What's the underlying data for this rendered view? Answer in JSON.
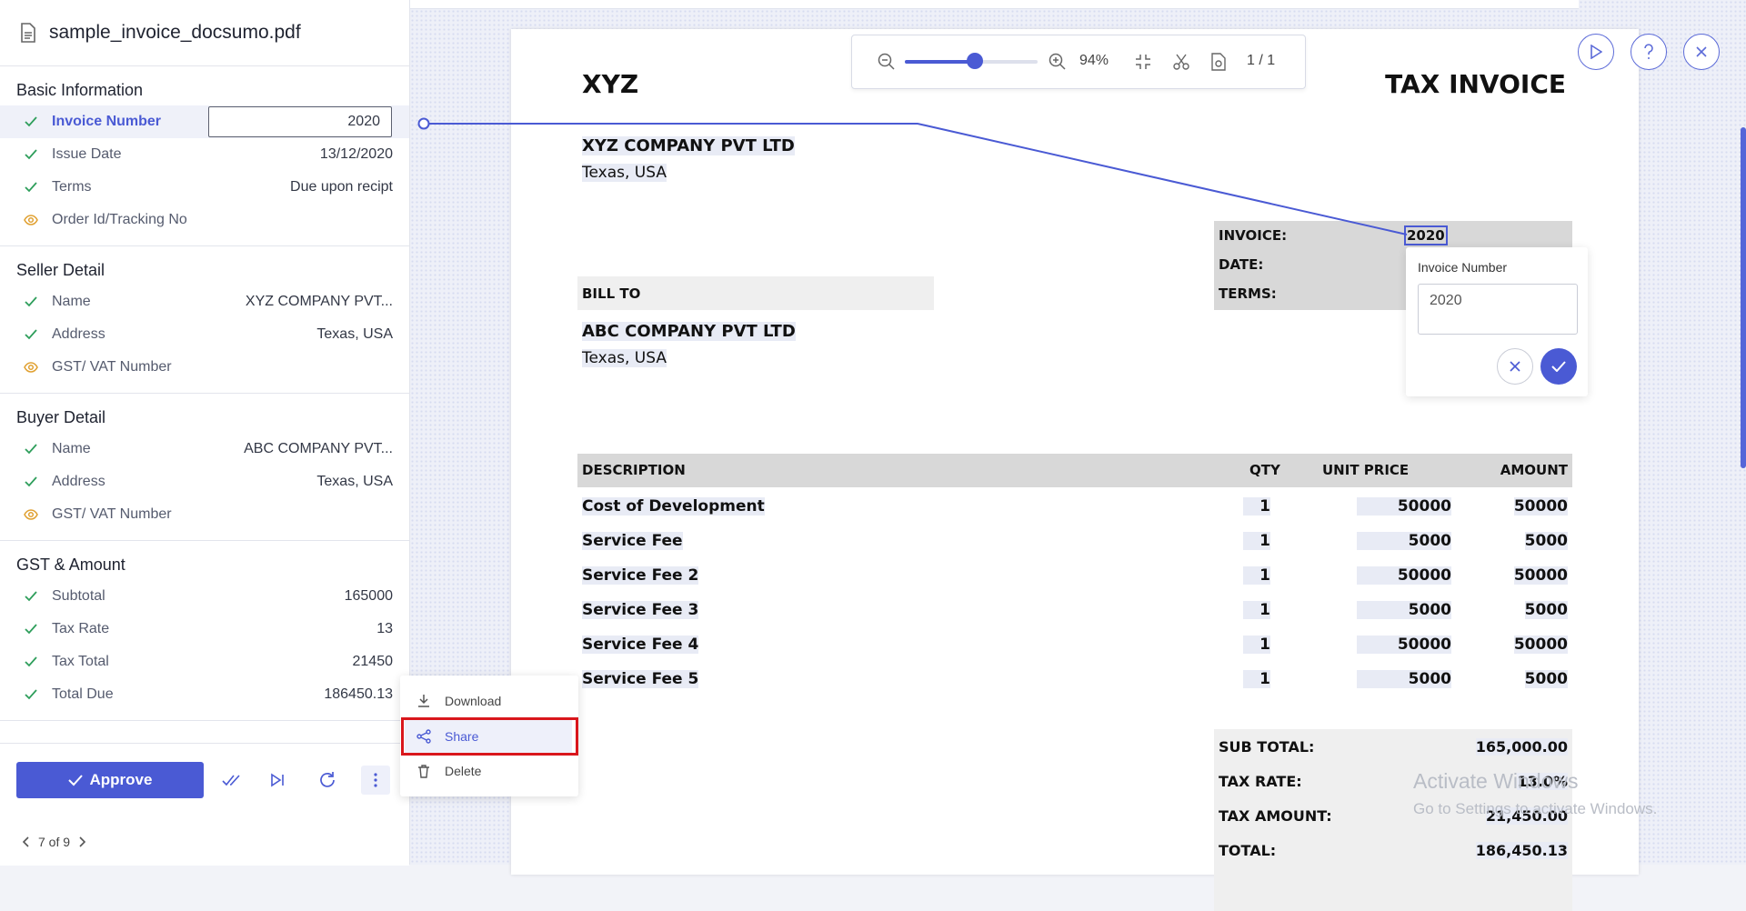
{
  "file_name": "sample_invoice_docsumo.pdf",
  "sections": [
    {
      "title": "Basic Information",
      "fields": [
        {
          "label": "Invoice Number",
          "value": "2020",
          "status": "check"
        },
        {
          "label": "Issue Date",
          "value": "13/12/2020",
          "status": "check"
        },
        {
          "label": "Terms",
          "value": "Due upon recipt",
          "status": "check"
        },
        {
          "label": "Order Id/Tracking No",
          "value": "",
          "status": "eye"
        }
      ]
    },
    {
      "title": "Seller Detail",
      "fields": [
        {
          "label": "Name",
          "value": "XYZ COMPANY PVT...",
          "status": "check"
        },
        {
          "label": "Address",
          "value": "Texas, USA",
          "status": "check"
        },
        {
          "label": "GST/ VAT Number",
          "value": "",
          "status": "eye"
        }
      ]
    },
    {
      "title": "Buyer Detail",
      "fields": [
        {
          "label": "Name",
          "value": "ABC COMPANY PVT...",
          "status": "check"
        },
        {
          "label": "Address",
          "value": "Texas, USA",
          "status": "check"
        },
        {
          "label": "GST/ VAT Number",
          "value": "",
          "status": "eye"
        }
      ]
    },
    {
      "title": "GST & Amount",
      "fields": [
        {
          "label": "Subtotal",
          "value": "165000",
          "status": "check"
        },
        {
          "label": "Tax Rate",
          "value": "13",
          "status": "check"
        },
        {
          "label": "Tax Total",
          "value": "21450",
          "status": "check"
        },
        {
          "label": "Total Due",
          "value": "186450.13",
          "status": "check"
        }
      ]
    }
  ],
  "actions": {
    "approve": "Approve"
  },
  "pager": {
    "text": "7 of 9"
  },
  "menu": {
    "download": "Download",
    "share": "Share",
    "delete": "Delete"
  },
  "toolbar": {
    "zoom_label": "94%",
    "zoom_level": 0.53,
    "page_current": "1",
    "page_sep": "/",
    "page_total": "1"
  },
  "invoice": {
    "company_short": "XYZ",
    "doc_title": "TAX INVOICE",
    "seller_name": "XYZ COMPANY PVT LTD",
    "seller_address": "Texas, USA",
    "meta_labels": {
      "invoice": "INVOICE:",
      "date": "DATE:",
      "terms": "TERMS:"
    },
    "invoice_number": "2020",
    "bill_to_label": "BILL TO",
    "buyer_name": "ABC COMPANY PVT LTD",
    "buyer_address": "Texas, USA",
    "columns": {
      "description": "DESCRIPTION",
      "qty": "QTY",
      "unit_price": "UNIT PRICE",
      "amount": "AMOUNT"
    },
    "items": [
      {
        "description": "Cost of Development",
        "qty": "1",
        "unit_price": "50000",
        "amount": "50000"
      },
      {
        "description": "Service Fee",
        "qty": "1",
        "unit_price": "5000",
        "amount": "5000"
      },
      {
        "description": "Service Fee 2",
        "qty": "1",
        "unit_price": "50000",
        "amount": "50000"
      },
      {
        "description": "Service Fee 3",
        "qty": "1",
        "unit_price": "5000",
        "amount": "5000"
      },
      {
        "description": "Service Fee 4",
        "qty": "1",
        "unit_price": "50000",
        "amount": "50000"
      },
      {
        "description": "Service Fee 5",
        "qty": "1",
        "unit_price": "5000",
        "amount": "5000"
      }
    ],
    "totals": [
      {
        "label": "SUB TOTAL:",
        "value": "165,000.00"
      },
      {
        "label": "TAX RATE:",
        "value": "13.0%"
      },
      {
        "label": "TAX AMOUNT:",
        "value": "21,450.00"
      },
      {
        "label": "TOTAL:",
        "value": "186,450.13"
      }
    ]
  },
  "popup": {
    "title": "Invoice Number",
    "value": "2020"
  },
  "watermark": {
    "line1": "Activate Windows",
    "line2": "Go to Settings to activate Windows."
  },
  "colors": {
    "accent": "#4a5ad4",
    "check": "#2e9e5b",
    "eye": "#e0a030",
    "highlight_box": "#d9161c"
  },
  "icons": {
    "file": "document-icon",
    "check": "check-icon",
    "eye": "eye-icon",
    "more": "more-vertical-icon"
  }
}
